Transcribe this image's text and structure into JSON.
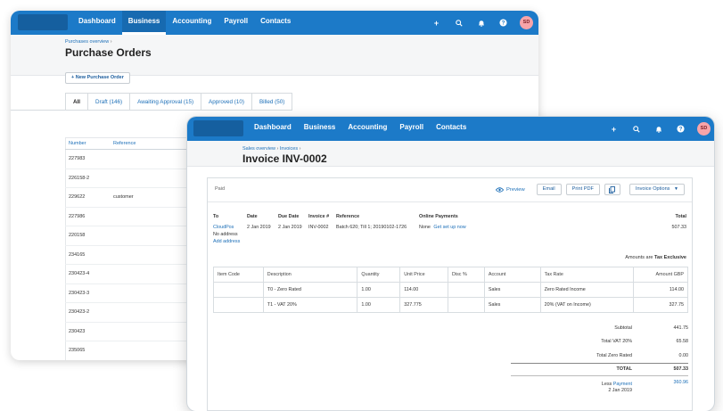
{
  "back_window": {
    "nav": [
      "Dashboard",
      "Business",
      "Accounting",
      "Payroll",
      "Contacts"
    ],
    "active_nav": "Business",
    "avatar": "SD",
    "breadcrumb": "Purchases overview",
    "breadcrumb_sep": "›",
    "title": "Purchase Orders",
    "new_button": "+ New Purchase Order",
    "tabs": [
      "All",
      "Draft (146)",
      "Awaiting Approval (15)",
      "Approved (10)",
      "Billed (50)"
    ],
    "table": {
      "headers": [
        "Number",
        "Reference"
      ],
      "rows": [
        [
          "227983",
          ""
        ],
        [
          "226158-2",
          ""
        ],
        [
          "229622",
          "customer"
        ],
        [
          "227986",
          ""
        ],
        [
          "220158",
          ""
        ],
        [
          "234165",
          ""
        ],
        [
          "230423-4",
          ""
        ],
        [
          "230423-3",
          ""
        ],
        [
          "230423-2",
          ""
        ],
        [
          "230423",
          ""
        ],
        [
          "235065",
          ""
        ]
      ]
    }
  },
  "front_window": {
    "nav": [
      "Dashboard",
      "Business",
      "Accounting",
      "Payroll",
      "Contacts"
    ],
    "avatar": "SD",
    "breadcrumb": [
      "Sales overview",
      "Invoices"
    ],
    "breadcrumb_sep": "›",
    "title": "Invoice INV-0002",
    "status": "Paid",
    "actions": {
      "preview": "Preview",
      "email": "Email",
      "print_pdf": "Print PDF",
      "invoice_options": "Invoice Options"
    },
    "meta": {
      "to_label": "To",
      "to_name": "CloudPos",
      "to_address": "No address",
      "add_address": "Add address",
      "date_label": "Date",
      "date": "2 Jan 2019",
      "due_label": "Due Date",
      "due": "2 Jan 2019",
      "invoice_label": "Invoice #",
      "invoice_no": "INV-0002",
      "reference_label": "Reference",
      "reference": "Batch 620; Till 1; 20190102-1726",
      "online_label": "Online Payments",
      "online_value": "None",
      "online_link": "Get set up now",
      "total_label": "Total",
      "total": "507.33"
    },
    "amounts_are_label": "Amounts are",
    "amounts_are_value": "Tax Exclusive",
    "line_headers": [
      "Item Code",
      "Description",
      "Quantity",
      "Unit Price",
      "Disc %",
      "Account",
      "Tax Rate",
      "Amount GBP"
    ],
    "lines": [
      [
        "",
        "T0 - Zero Rated",
        "1.00",
        "114.00",
        "",
        "Sales",
        "Zero Rated Income",
        "114.00"
      ],
      [
        "",
        "T1 - VAT 20%",
        "1.00",
        "327.775",
        "",
        "Sales",
        "20% (VAT on Income)",
        "327.75"
      ]
    ],
    "totals": {
      "subtotal_label": "Subtotal",
      "subtotal": "441.75",
      "vat_label": "Total VAT  20%",
      "vat": "65.58",
      "zero_label": "Total Zero Rated",
      "zero": "0.00",
      "total_label": "TOTAL",
      "total": "507.33",
      "less_label": "Less",
      "payment_label": "Payment",
      "payment_date": "2 Jan 2019",
      "payment": "360.96"
    }
  }
}
